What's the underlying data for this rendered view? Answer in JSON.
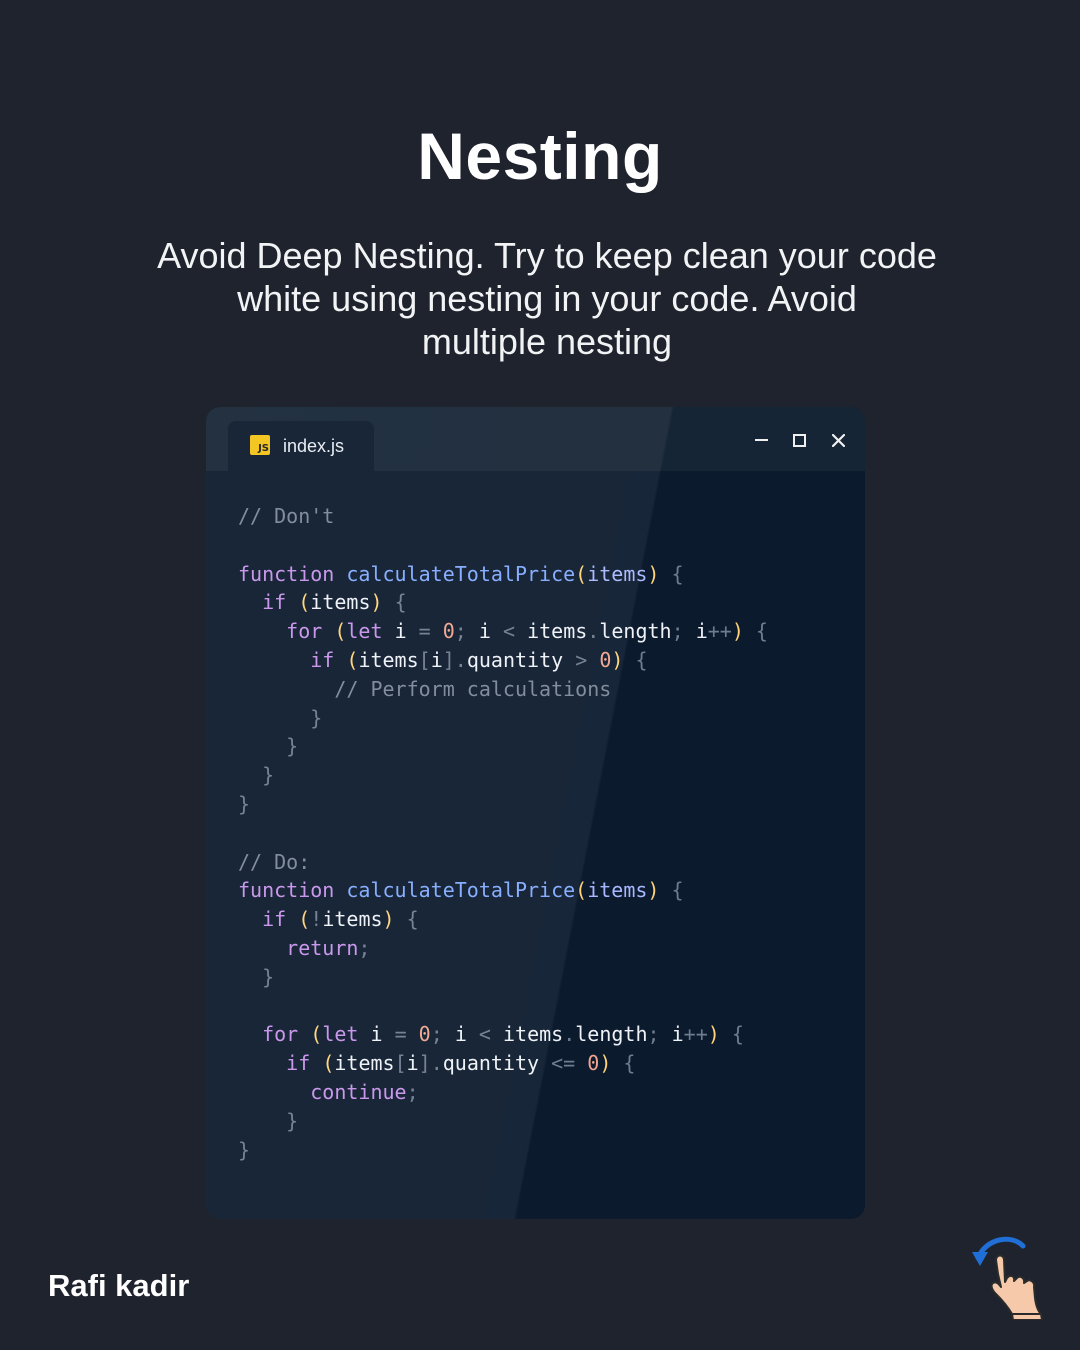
{
  "header": {
    "title": "Nesting",
    "subtitle_lines": [
      "Avoid Deep Nesting. Try to keep clean your code",
      "white using nesting in your code. Avoid",
      "multiple nesting"
    ]
  },
  "editor": {
    "tab": {
      "icon": "js-file-icon",
      "icon_text": "JS",
      "label": "index.js"
    },
    "window_controls": [
      "minimize-icon",
      "maximize-icon",
      "close-icon"
    ],
    "code_lines": [
      "// Don't",
      "",
      "function calculateTotalPrice(items) {",
      "  if (items) {",
      "    for (let i = 0; i < items.length; i++) {",
      "      if (items[i].quantity > 0) {",
      "        // Perform calculations",
      "      }",
      "    }",
      "  }",
      "}",
      "",
      "// Do:",
      "function calculateTotalPrice(items) {",
      "  if (!items) {",
      "    return;",
      "  }",
      "",
      "  for (let i = 0; i < items.length; i++) {",
      "    if (items[i].quantity <= 0) {",
      "      continue;",
      "    }",
      "}"
    ]
  },
  "footer": {
    "author": "Rafi kadir",
    "swipe_icon": "swipe-hand-icon"
  },
  "colors": {
    "background": "#1f232d",
    "editor_background": "#0b1a2d",
    "titlebar": "#162536",
    "keyword": "#c792ea",
    "function_name": "#82aaff",
    "number": "#f0a48e",
    "comment": "#7b8798",
    "js_badge": "#f3c318"
  }
}
